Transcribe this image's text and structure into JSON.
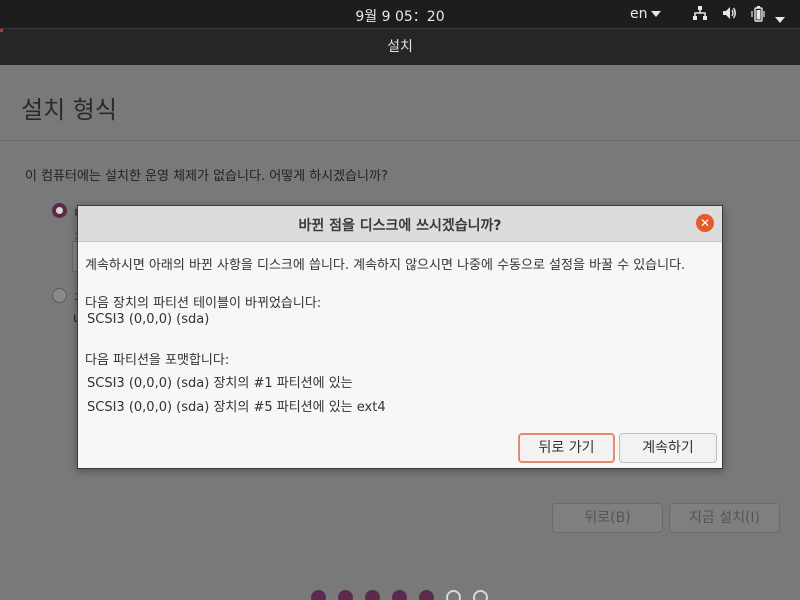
{
  "topbar": {
    "clock": "9월 9  05：20",
    "language": "en",
    "icons": [
      "network-icon",
      "volume-icon",
      "battery-icon",
      "system-menu-caret-icon"
    ]
  },
  "window": {
    "title": "설치"
  },
  "page": {
    "heading": "설치 형식",
    "question": "이 컴퓨터에는 설치한 운영 체제가 없습니다. 어떻게 하시겠습니까?",
    "option1_partial": "ㅁ",
    "option1_sub_partial": "ㅈ",
    "option2_partial": "ㅈ",
    "option2_sub_partial": "u"
  },
  "buttons": {
    "back": "뒤로(B)",
    "install_now": "지금 설치(I)"
  },
  "progress": {
    "total_steps": 7,
    "completed_steps": 5
  },
  "dialog": {
    "title": "바뀐 점을 디스크에 쓰시겠습니까?",
    "intro": "계속하시면 아래의 바뀐 사항을 디스크에 씁니다. 계속하지 않으시면 나중에 수동으로 설정을 바꿀 수 있습니다.",
    "partition_table_heading": "다음 장치의 파티션 테이블이 바뀌었습니다:",
    "partition_table_devices": [
      "SCSI3 (0,0,0) (sda)"
    ],
    "format_heading": "다음 파티션을 포맷합니다:",
    "format_items": [
      "SCSI3 (0,0,0) (sda) 장치의 #1 파티션에 있는",
      "SCSI3 (0,0,0) (sda) 장치의 #5 파티션에 있는 ext4"
    ],
    "go_back_label": "뒤로 가기",
    "continue_label": "계속하기"
  },
  "colors": {
    "close_button": "#e45a2b",
    "progress_dot": "#5c2a4d",
    "focus_border": "#e58a6e"
  }
}
